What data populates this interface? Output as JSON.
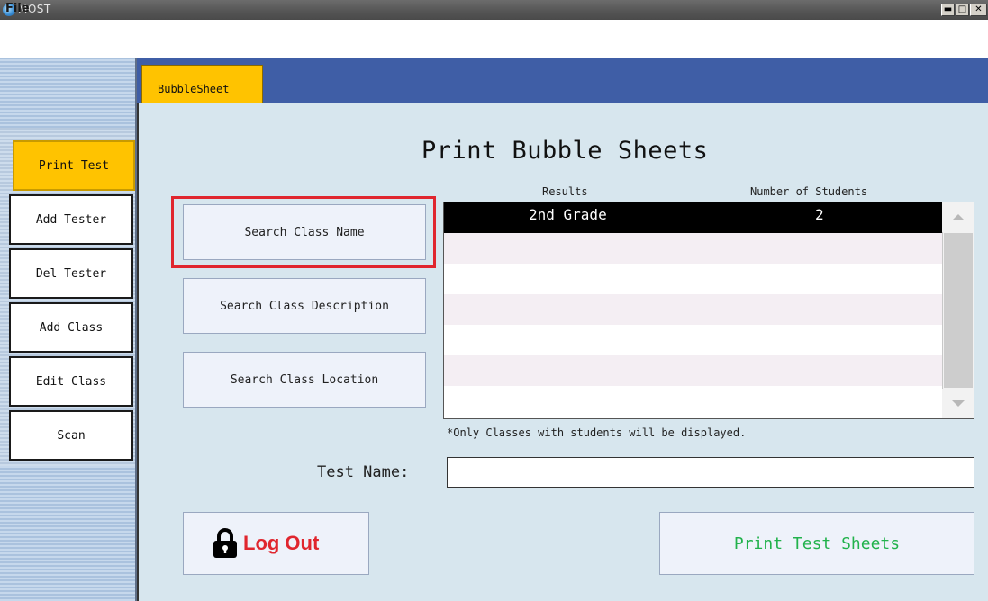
{
  "window": {
    "title": "MOST"
  },
  "menu": {
    "file": "File"
  },
  "sidebar": {
    "items": [
      {
        "label": "Print Test"
      },
      {
        "label": "Add Tester"
      },
      {
        "label": "Del Tester"
      },
      {
        "label": "Add Class"
      },
      {
        "label": "Edit Class"
      },
      {
        "label": "Scan"
      }
    ]
  },
  "tabs": [
    {
      "label": "BubbleSheet"
    }
  ],
  "main": {
    "title": "Print Bubble Sheets",
    "search_buttons": [
      {
        "label": "Search Class Name"
      },
      {
        "label": "Search Class Description"
      },
      {
        "label": "Search Class Location"
      }
    ],
    "results": {
      "headers": {
        "results": "Results",
        "students": "Number of Students"
      },
      "rows": [
        {
          "name": "2nd Grade",
          "students": "2"
        }
      ],
      "note": "*Only Classes with students will be displayed."
    },
    "test_name": {
      "label": "Test Name:",
      "value": ""
    },
    "logout_label": "Log Out",
    "print_label": "Print Test Sheets"
  },
  "colors": {
    "accent": "#ffc300",
    "tab_strip": "#3f5ea6",
    "panel": "#d7e6ee",
    "highlight": "#e0262e",
    "print_text": "#22b24c"
  }
}
